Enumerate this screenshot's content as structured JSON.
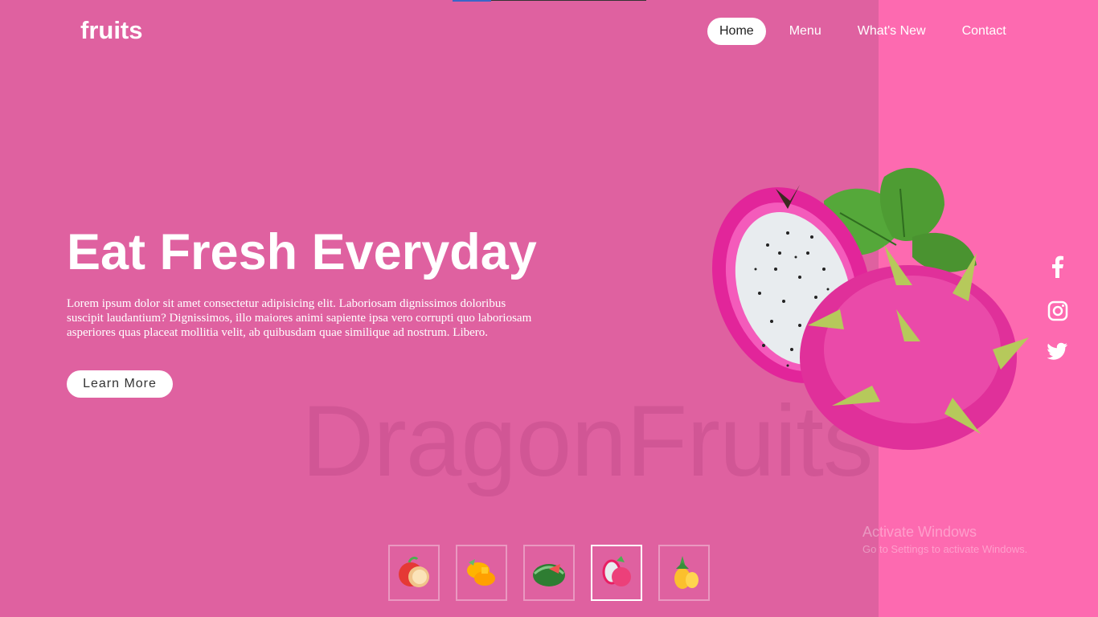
{
  "header": {
    "logo": "fruits",
    "nav": [
      "Home",
      "Menu",
      "What's New",
      "Contact"
    ],
    "active_nav": "Home"
  },
  "hero": {
    "title": "Eat Fresh Everyday",
    "text": "Lorem ipsum dolor sit amet consectetur adipisicing elit. Laboriosam dignissimos doloribus suscipit laudantium? Dignissimos, illo maiores animi sapiente ipsa vero corrupti quo laboriosam asperiores quas placeat mollitia velit, ab quibusdam quae similique ad nostrum. Libero.",
    "button": "Learn More",
    "watermark": "DragonFruits",
    "image": "dragon-fruit-image"
  },
  "social": [
    "facebook-icon",
    "instagram-icon",
    "twitter-icon"
  ],
  "thumbnails": [
    "apple",
    "mango",
    "watermelon",
    "dragon-fruit",
    "pineapple"
  ],
  "active_thumbnail": "dragon-fruit",
  "os_overlay": {
    "title": "Activate Windows",
    "subtitle": "Go to Settings to activate Windows."
  },
  "colors": {
    "background": "#df61a0",
    "right_panel": "#fd6ab0",
    "text": "#ffffff"
  }
}
